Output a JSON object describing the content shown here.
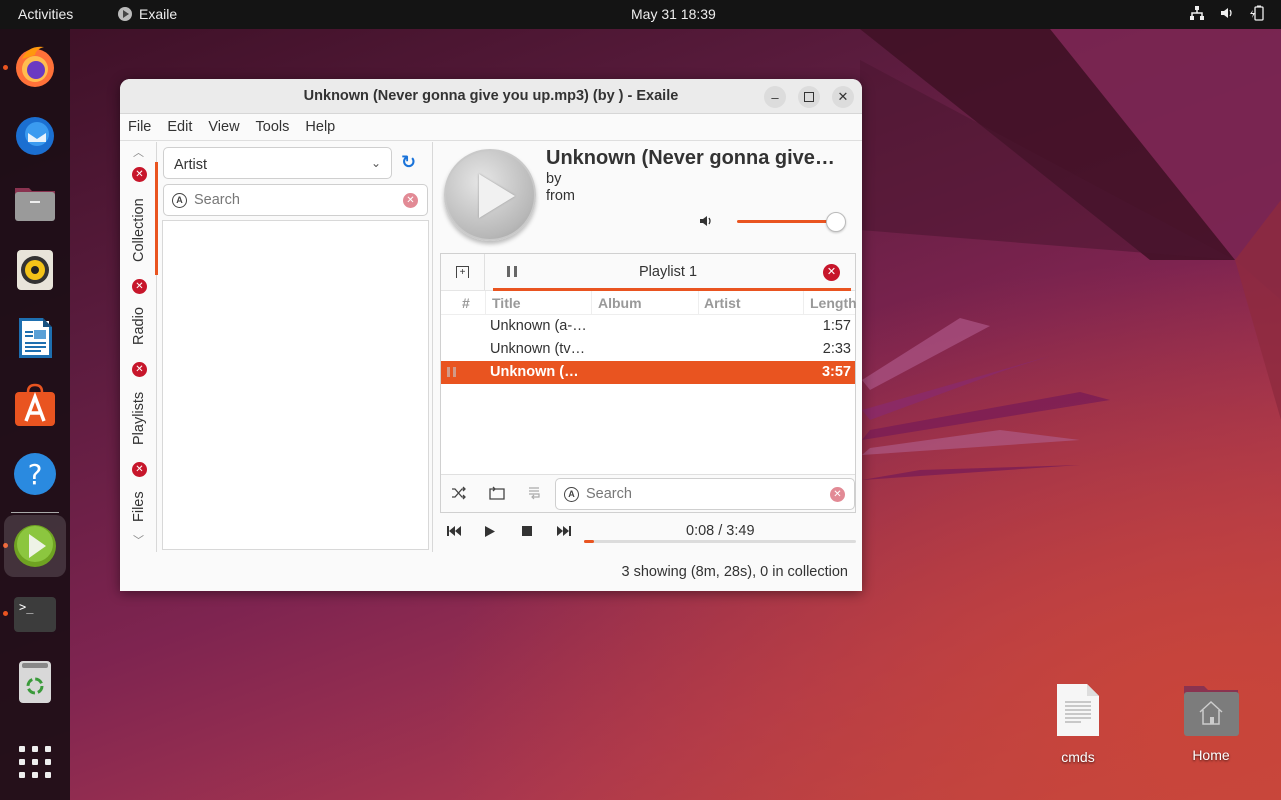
{
  "topbar": {
    "activities": "Activities",
    "app_name": "Exaile",
    "clock": "May 31  18:39",
    "tray_icons": [
      "network-icon",
      "volume-icon",
      "battery-icon"
    ]
  },
  "dock": {
    "items": [
      {
        "name": "firefox",
        "running": true
      },
      {
        "name": "thunderbird",
        "running": false
      },
      {
        "name": "files",
        "running": false
      },
      {
        "name": "rhythmbox",
        "running": false
      },
      {
        "name": "libreoffice-writer",
        "running": false
      },
      {
        "name": "ubuntu-software",
        "running": false
      },
      {
        "name": "help",
        "running": false
      },
      {
        "name": "exaile",
        "running": true,
        "active": true
      },
      {
        "name": "terminal",
        "running": true
      },
      {
        "name": "trash",
        "running": false
      },
      {
        "name": "show-apps",
        "running": false
      }
    ]
  },
  "desktop": {
    "icons": [
      {
        "label": "cmds",
        "icon": "text-file-icon"
      },
      {
        "label": "Home",
        "icon": "home-folder-icon"
      }
    ]
  },
  "window": {
    "title": "Unknown (Never gonna give you up.mp3) (by ) - Exaile",
    "menu": [
      "File",
      "Edit",
      "View",
      "Tools",
      "Help"
    ],
    "side_tabs": [
      {
        "label": "Collection",
        "active": true
      },
      {
        "label": "Radio",
        "active": false
      },
      {
        "label": "Playlists",
        "active": false
      },
      {
        "label": "Files",
        "active": false
      }
    ],
    "collection": {
      "view_selected": "Artist",
      "search_placeholder": "Search"
    },
    "now_playing": {
      "title": "Unknown (Never gonna give…",
      "by": "by",
      "from": "from",
      "volume_fraction": 1.0
    },
    "playlist": {
      "tab_name": "Playlist 1",
      "columns": [
        "#",
        "Title",
        "Album",
        "Artist",
        "Length"
      ],
      "rows": [
        {
          "num": "",
          "title": "Unknown (a-…",
          "album": "",
          "artist": "",
          "length": "1:57",
          "playing": false
        },
        {
          "num": "",
          "title": "Unknown (tv…",
          "album": "",
          "artist": "",
          "length": "2:33",
          "playing": false
        },
        {
          "num": "",
          "title": "Unknown (…",
          "album": "",
          "artist": "",
          "length": "3:57",
          "playing": true
        }
      ],
      "search_placeholder": "Search"
    },
    "transport": {
      "time": "0:08 / 3:49",
      "progress_fraction": 0.035
    },
    "status": "3 showing (8m, 28s), 0 in collection"
  },
  "colors": {
    "accent": "#e95420",
    "close_badge": "#c7162b",
    "refresh": "#1a73d9"
  }
}
